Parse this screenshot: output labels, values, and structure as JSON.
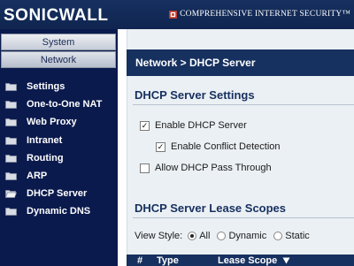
{
  "header": {
    "logo": "SONICWALL",
    "tagline": "COMPREHENSIVE INTERNET SECURITY™"
  },
  "sidebar": {
    "tabs": [
      {
        "label": "System"
      },
      {
        "label": "Network",
        "selected": true
      }
    ],
    "items": [
      {
        "label": "Settings"
      },
      {
        "label": "One-to-One NAT"
      },
      {
        "label": "Web Proxy"
      },
      {
        "label": "Intranet"
      },
      {
        "label": "Routing"
      },
      {
        "label": "ARP"
      },
      {
        "label": "DHCP Server",
        "selected": true
      },
      {
        "label": "Dynamic DNS"
      }
    ]
  },
  "main": {
    "page_title": "Network > DHCP Server",
    "settings_title": "DHCP Server Settings",
    "enable_dhcp": {
      "label": "Enable DHCP Server",
      "checked": true
    },
    "conflict_detection": {
      "label": "Enable Conflict Detection",
      "checked": true
    },
    "pass_through": {
      "label": "Allow DHCP Pass Through",
      "checked": false
    },
    "lease_title": "DHCP Server Lease Scopes",
    "view_style": {
      "label": "View Style:",
      "options": [
        "All",
        "Dynamic",
        "Static"
      ],
      "selected": "All"
    },
    "table": {
      "col_num": "#",
      "col_type": "Type",
      "col_scope": "Lease Scope"
    }
  },
  "colors": {
    "header_bg": "#16305f",
    "sidebar_bg": "#0b1a4d",
    "panel_bg": "#ebf0f4",
    "accent": "#f0a020"
  }
}
